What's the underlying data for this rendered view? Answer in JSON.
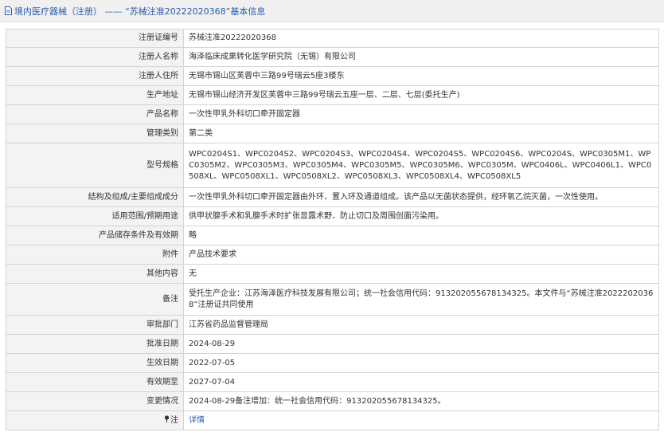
{
  "header": {
    "title": "境内医疗器械（注册） —— “苏械注准20222020368”基本信息",
    "icon": "document-icon",
    "accent": "#2a5caa"
  },
  "rows": [
    {
      "label": "注册证编号",
      "value": "苏械注准20222020368"
    },
    {
      "label": "注册人名称",
      "value": "海泽临床成果转化医学研究院（无锡）有限公司"
    },
    {
      "label": "注册人住所",
      "value": "无锡市锡山区芙蓉中三路99号瑞云5座3楼东"
    },
    {
      "label": "生产地址",
      "value": "无锡市锡山经济开发区芙蓉中三路99号瑞云五座一层、二层、七层(委托生产)"
    },
    {
      "label": "产品名称",
      "value": "一次性甲乳外科切口牵开固定器"
    },
    {
      "label": "管理类别",
      "value": "第二类"
    },
    {
      "label": "型号规格",
      "value": "WPC0204S1、WPC0204S2、WPC0204S3、WPC0204S4、WPC0204S5、WPC0204S6、WPC0204S、WPC0305M1、WPC0305M2、WPC0305M3、WPC0305M4、WPC0305M5、WPC0305M6、WPC0305M、WPC0406L、WPC0406L1、WPC0508XL、WPC0508XL1、WPC0508XL2、WPC0508XL3、WPC0508XL4、WPC0508XL5"
    },
    {
      "label": "结构及组成/主要组成成分",
      "value": "一次性甲乳外科切口牵开固定器由外环、置入环及通道组成。该产品以无菌状态提供，经环氧乙烷灭菌，一次性使用。"
    },
    {
      "label": "适用范围/预期用途",
      "value": "供甲状腺手术和乳腺手术时扩张显露术野、防止切口及周围创面污染用。"
    },
    {
      "label": "产品储存条件及有效期",
      "value": "略"
    },
    {
      "label": "附件",
      "value": "产品技术要求"
    },
    {
      "label": "其他内容",
      "value": "无"
    },
    {
      "label": "备注",
      "value": "受托生产企业：江苏海泽医疗科技发展有限公司；统一社会信用代码：913202055678134325。本文件与“苏械注准20222020368”注册证共同使用"
    },
    {
      "label": "审批部门",
      "value": "江苏省药品监督管理局"
    },
    {
      "label": "批准日期",
      "value": "2024-08-29"
    },
    {
      "label": "生效日期",
      "value": "2022-07-05"
    },
    {
      "label": "有效期至",
      "value": "2027-07-04"
    },
    {
      "label": "变更情况",
      "value": "2024-08-29备注增加：统一社会信用代码：913202055678134325。"
    }
  ],
  "note_row": {
    "icon": "pin-icon",
    "label": "注",
    "link_text": "详情"
  }
}
